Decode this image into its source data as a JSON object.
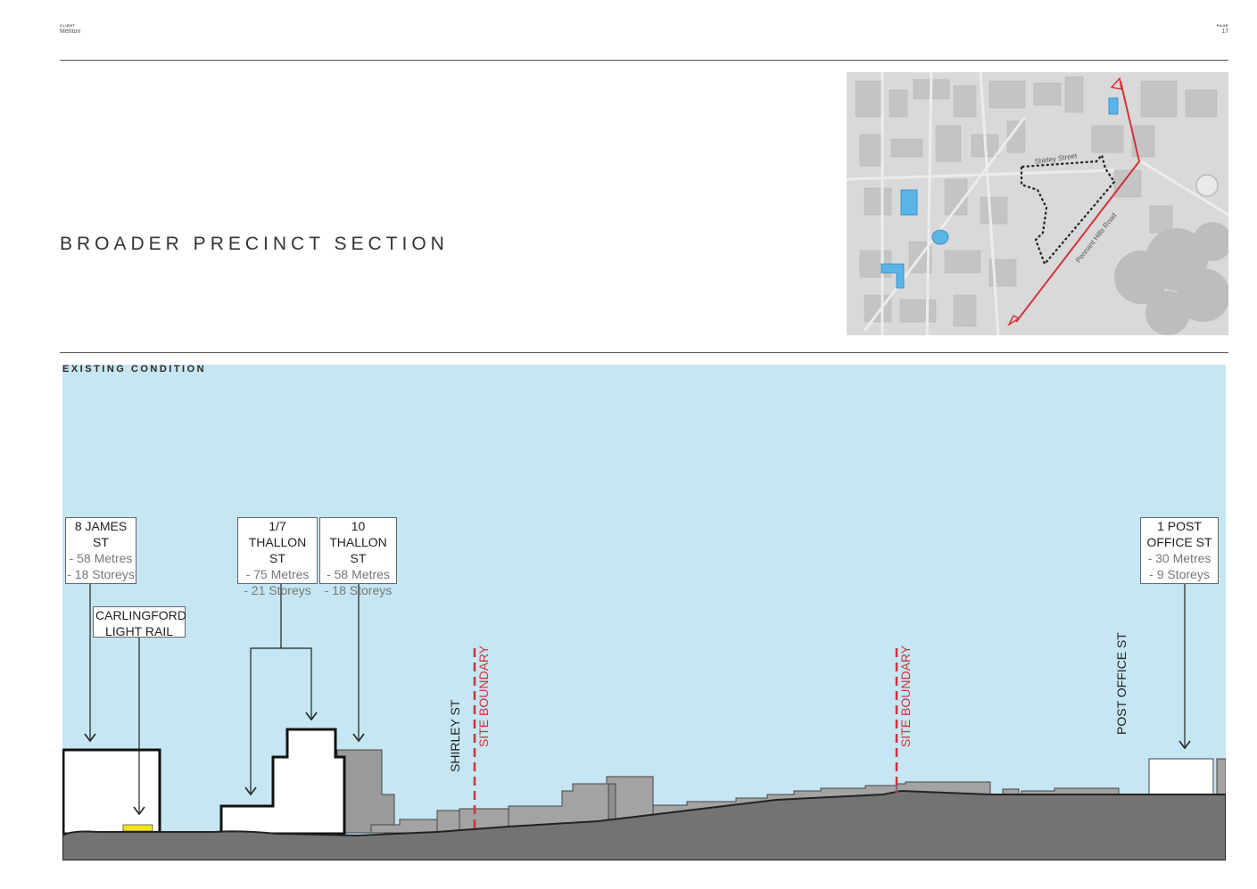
{
  "header": {
    "client_label": "CLIENT",
    "client_name": "Meriton",
    "page_label": "PAGE",
    "page_number": "17"
  },
  "title": "BROADER PRECINCT SECTION",
  "map": {
    "street_label_1": "Shirley Street",
    "street_label_2": "Pennant Hills Road",
    "colors": {
      "section_line": "#d0323a",
      "highlight": "#5ab4e8",
      "boundary": "#222222"
    }
  },
  "section": {
    "label": "EXISTING CONDITION",
    "sky_color": "#c5e6f2",
    "ground_color": "#737373",
    "callouts": [
      {
        "id": "8-james",
        "title": "8 JAMES ST",
        "lines": [
          "- 58 Metres",
          "- 18 Storeys"
        ]
      },
      {
        "id": "carlingford",
        "title": "CARLINGFORD LIGHT RAIL",
        "lines": []
      },
      {
        "id": "1-7-thallon",
        "title": "1/7 THALLON ST",
        "lines": [
          "- 75 Metres",
          "- 21 Storeys"
        ]
      },
      {
        "id": "10-thallon",
        "title": "10 THALLON ST",
        "lines": [
          "- 58 Metres",
          "- 18 Storeys"
        ]
      },
      {
        "id": "1-post-office",
        "title": "1 POST OFFICE ST",
        "lines": [
          "- 30 Metres",
          "- 9 Storeys"
        ]
      }
    ],
    "vertical_labels": {
      "shirley": "SHIRLEY ST",
      "site_boundary_1": "SITE BOUNDARY",
      "site_boundary_2": "SITE BOUNDARY",
      "post_office": "POST OFFICE ST"
    }
  }
}
